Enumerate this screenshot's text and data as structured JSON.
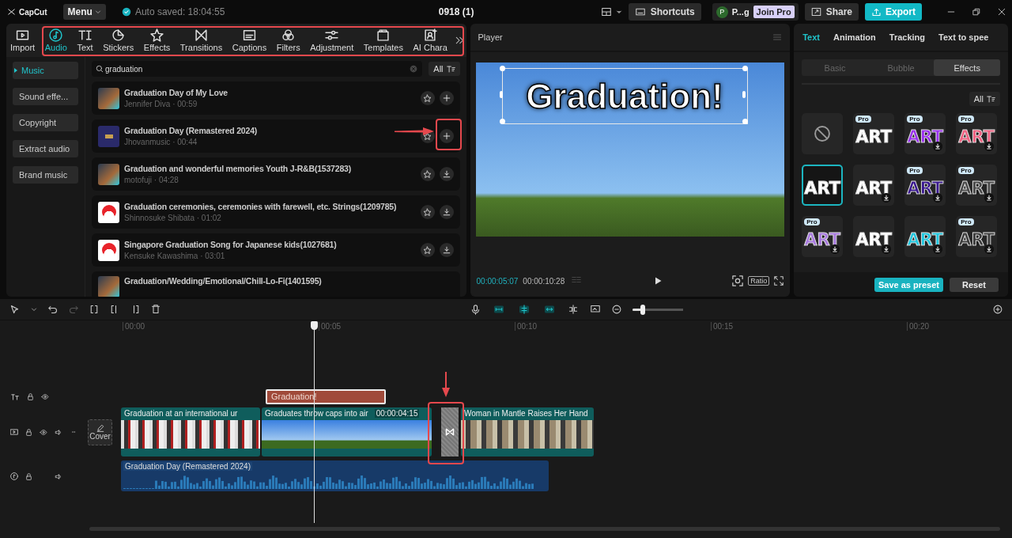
{
  "top_bar": {
    "logo": "CapCut",
    "menu": "Menu",
    "autosave": "Auto saved: 18:04:55",
    "project": "0918 (1)",
    "shortcuts": "Shortcuts",
    "account_initial": "P",
    "account_name": "P...g",
    "join_pro": "Join Pro",
    "share": "Share",
    "export": "Export"
  },
  "media_tabs": [
    {
      "label": "Import",
      "selected": false
    },
    {
      "label": "Audio",
      "selected": true
    },
    {
      "label": "Text",
      "selected": false
    },
    {
      "label": "Stickers",
      "selected": false
    },
    {
      "label": "Effects",
      "selected": false
    },
    {
      "label": "Transitions",
      "selected": false
    },
    {
      "label": "Captions",
      "selected": false
    },
    {
      "label": "Filters",
      "selected": false
    },
    {
      "label": "Adjustment",
      "selected": false
    },
    {
      "label": "Templates",
      "selected": false
    },
    {
      "label": "AI Chara",
      "selected": false
    }
  ],
  "library": {
    "sidebar": [
      {
        "label": "Music",
        "selected": true
      },
      {
        "label": "Sound effe...",
        "selected": false
      },
      {
        "label": "Copyright",
        "selected": false
      },
      {
        "label": "Extract audio",
        "selected": false
      },
      {
        "label": "Brand music",
        "selected": false
      }
    ],
    "search": {
      "value": "graduation"
    },
    "filter": "All",
    "tracks": [
      {
        "title": "Graduation Day of My Love",
        "meta": "Jennifer Diva · 00:59",
        "thumbnail": {
          "kind": "photo"
        },
        "kind": "add"
      },
      {
        "title": "Graduation Day (Remastered 2024)",
        "meta": "Jhovanmusic · 00:44",
        "thumbnail": {
          "kind": "cover"
        },
        "kind": "add"
      },
      {
        "title": "Graduation and wonderful memories Youth J-R&B(1537283)",
        "meta": "motofuji · 04:28",
        "thumbnail": {
          "kind": "photo"
        },
        "kind": "download"
      },
      {
        "title": "Graduation ceremonies, ceremonies with farewell, etc. Strings(1209785)",
        "meta": "Shinnosuke Shibata · 01:02",
        "thumbnail": {
          "kind": "logo"
        },
        "kind": "download"
      },
      {
        "title": "Singapore Graduation Song for Japanese kids(1027681)",
        "meta": "Kensuke Kawashima · 03:01",
        "thumbnail": {
          "kind": "logo"
        },
        "kind": "download"
      },
      {
        "title": "Graduation/Wedding/Emotional/Chill-Lo-Fi(1401595)",
        "thumbnail": {
          "kind": "photo"
        },
        "kind": "partial"
      }
    ]
  },
  "player": {
    "title": "Player",
    "overlay_text": "Graduation!",
    "current_time": "00:00:05:07",
    "total_time": "00:00:10:28",
    "ratio": "Ratio"
  },
  "inspector": {
    "tabs": [
      {
        "label": "Text",
        "selected": true
      },
      {
        "label": "Animation",
        "selected": false
      },
      {
        "label": "Tracking",
        "selected": false
      },
      {
        "label": "Text to spee",
        "selected": false
      }
    ],
    "subtabs": [
      {
        "label": "Basic",
        "selected": false
      },
      {
        "label": "Bubble",
        "selected": false
      },
      {
        "label": "Effects",
        "selected": true
      }
    ],
    "filter": "All",
    "effects": [
      {
        "kind": "none",
        "selected": false
      },
      {
        "kind": "art",
        "label": "ART",
        "badge": "Pro",
        "download": false,
        "color": "#ffffff",
        "selected": false
      },
      {
        "kind": "art",
        "label": "ART",
        "badge": "Pro",
        "download": true,
        "color": "#9b30f0",
        "selected": false
      },
      {
        "kind": "art",
        "label": "ART",
        "badge": "Pro",
        "download": true,
        "color": "#f06080",
        "selected": false
      },
      {
        "kind": "art",
        "label": "ART",
        "download": false,
        "color": "#ffffff",
        "selected": true
      },
      {
        "kind": "art",
        "label": "ART",
        "download": true,
        "color": "#ffffff",
        "selected": false
      },
      {
        "kind": "art",
        "label": "ART",
        "badge": "Pro",
        "download": true,
        "color": "#3a1890",
        "selected": false
      },
      {
        "kind": "art",
        "label": "ART",
        "badge": "Pro",
        "download": true,
        "color": "#4a4a4a",
        "selected": false
      },
      {
        "kind": "art",
        "label": "ART",
        "badge": "Pro",
        "download": true,
        "color": "#a878e0",
        "selected": false
      },
      {
        "kind": "art",
        "label": "ART",
        "download": true,
        "color": "#ffffff",
        "selected": false
      },
      {
        "kind": "art",
        "label": "ART",
        "download": true,
        "color": "#1ec8e0",
        "selected": false
      },
      {
        "kind": "art",
        "label": "ART",
        "badge": "Pro",
        "download": true,
        "color": "#3c3c3c",
        "selected": false
      }
    ],
    "save_preset": "Save as preset",
    "reset": "Reset"
  },
  "timeline": {
    "zoom": {
      "level": 0.2
    },
    "ruler": [
      "00:00",
      "00:05",
      "00:10",
      "00:15",
      "00:20"
    ],
    "text_clips": [
      {
        "label": "Graduation!",
        "selected": true
      }
    ],
    "video_clips": [
      {
        "label": "Graduation at an international ur"
      },
      {
        "label": "Graduates throw caps into air",
        "duration": "00:00:04:15"
      },
      {
        "label": "Woman in Mantle Raises Her Hand"
      }
    ],
    "cover": "Cover",
    "audio_clips": [
      {
        "label": "Graduation Day (Remastered 2024)"
      }
    ]
  }
}
